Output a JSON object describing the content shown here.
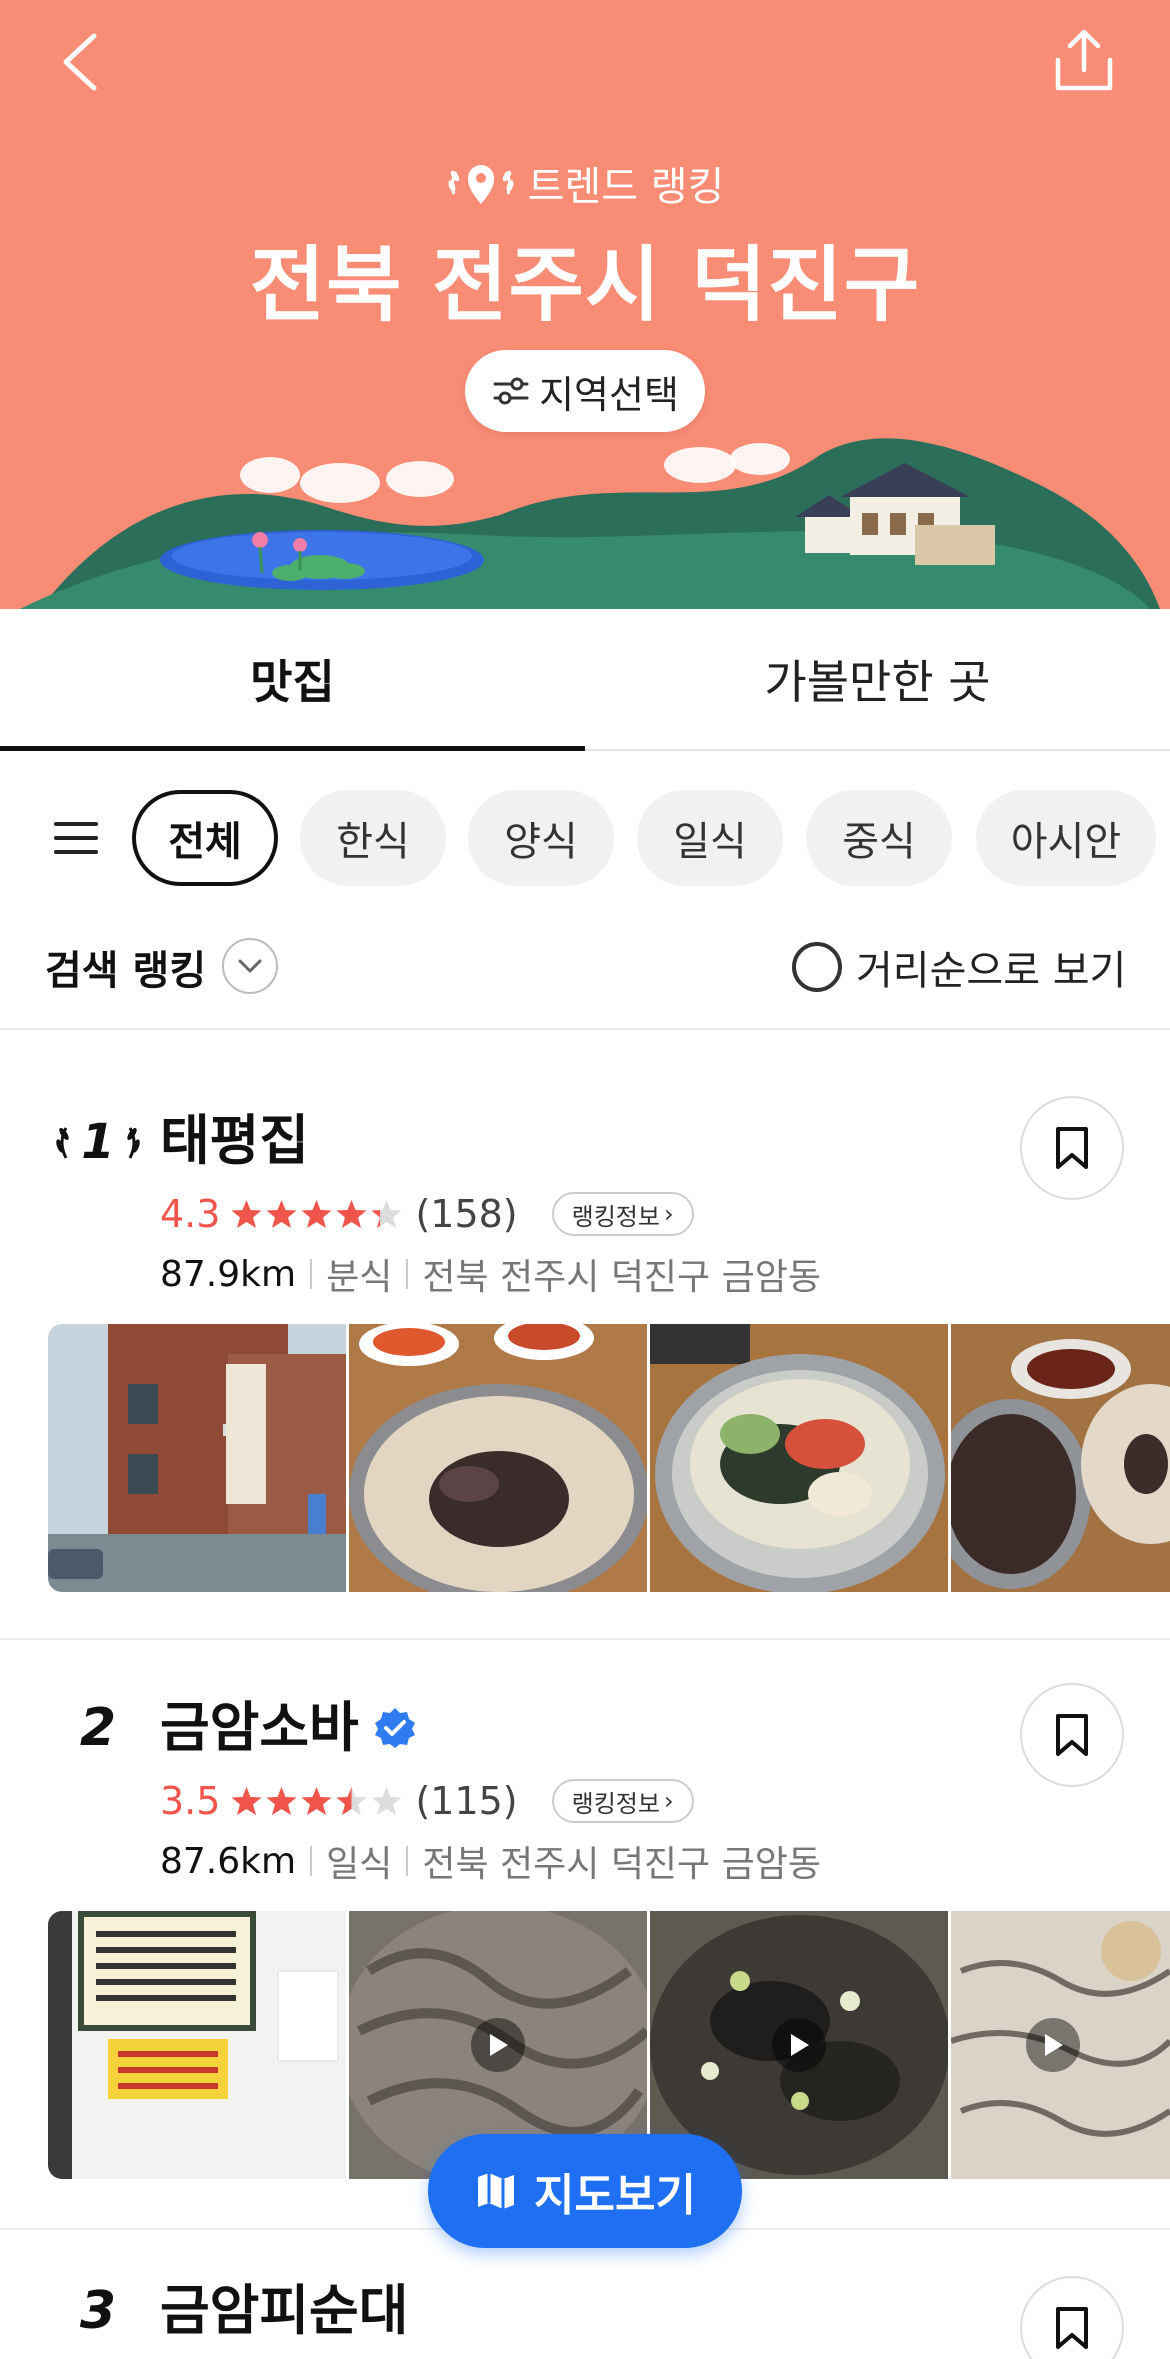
{
  "header": {
    "badge_label": "트렌드 랭킹",
    "region_title": "전북 전주시 덕진구",
    "region_select_label": "지역선택",
    "bg_color": "#F98C74"
  },
  "tabs": [
    {
      "label": "맛집",
      "active": true
    },
    {
      "label": "가볼만한 곳",
      "active": false
    }
  ],
  "categories": [
    {
      "label": "전체",
      "selected": true
    },
    {
      "label": "한식",
      "selected": false
    },
    {
      "label": "양식",
      "selected": false
    },
    {
      "label": "일식",
      "selected": false
    },
    {
      "label": "중식",
      "selected": false
    },
    {
      "label": "아시안",
      "selected": false
    }
  ],
  "sort": {
    "label": "검색 랭킹",
    "distance_toggle_label": "거리순으로 보기"
  },
  "restaurants": [
    {
      "rank": "1",
      "name": "태평집",
      "rating": "4.3",
      "rating_value": 4.3,
      "reviews": "(158)",
      "rank_info_label": "랭킹정보",
      "distance": "87.9km",
      "category": "분식",
      "address": "전북 전주시 덕진구 금암동",
      "verified": false,
      "photos": [
        "building-photo",
        "cold-bean-noodle-photo",
        "salad-noodle-photo",
        "buckwheat-noodle-photo"
      ]
    },
    {
      "rank": "2",
      "name": "금암소바",
      "rating": "3.5",
      "rating_value": 3.5,
      "reviews": "(115)",
      "rank_info_label": "랭킹정보",
      "distance": "87.6km",
      "category": "일식",
      "address": "전북 전주시 덕진구 금암동",
      "verified": true,
      "photos": [
        "menu-board-photo",
        "soba-video",
        "seaweed-soba-video",
        "cream-soba-video"
      ]
    },
    {
      "rank": "3",
      "name": "금암피순대"
    }
  ],
  "map_button_label": "지도보기",
  "colors": {
    "accent_red": "#F0554B",
    "map_blue": "#1E6FF2",
    "verified_blue": "#2F7BF2"
  }
}
